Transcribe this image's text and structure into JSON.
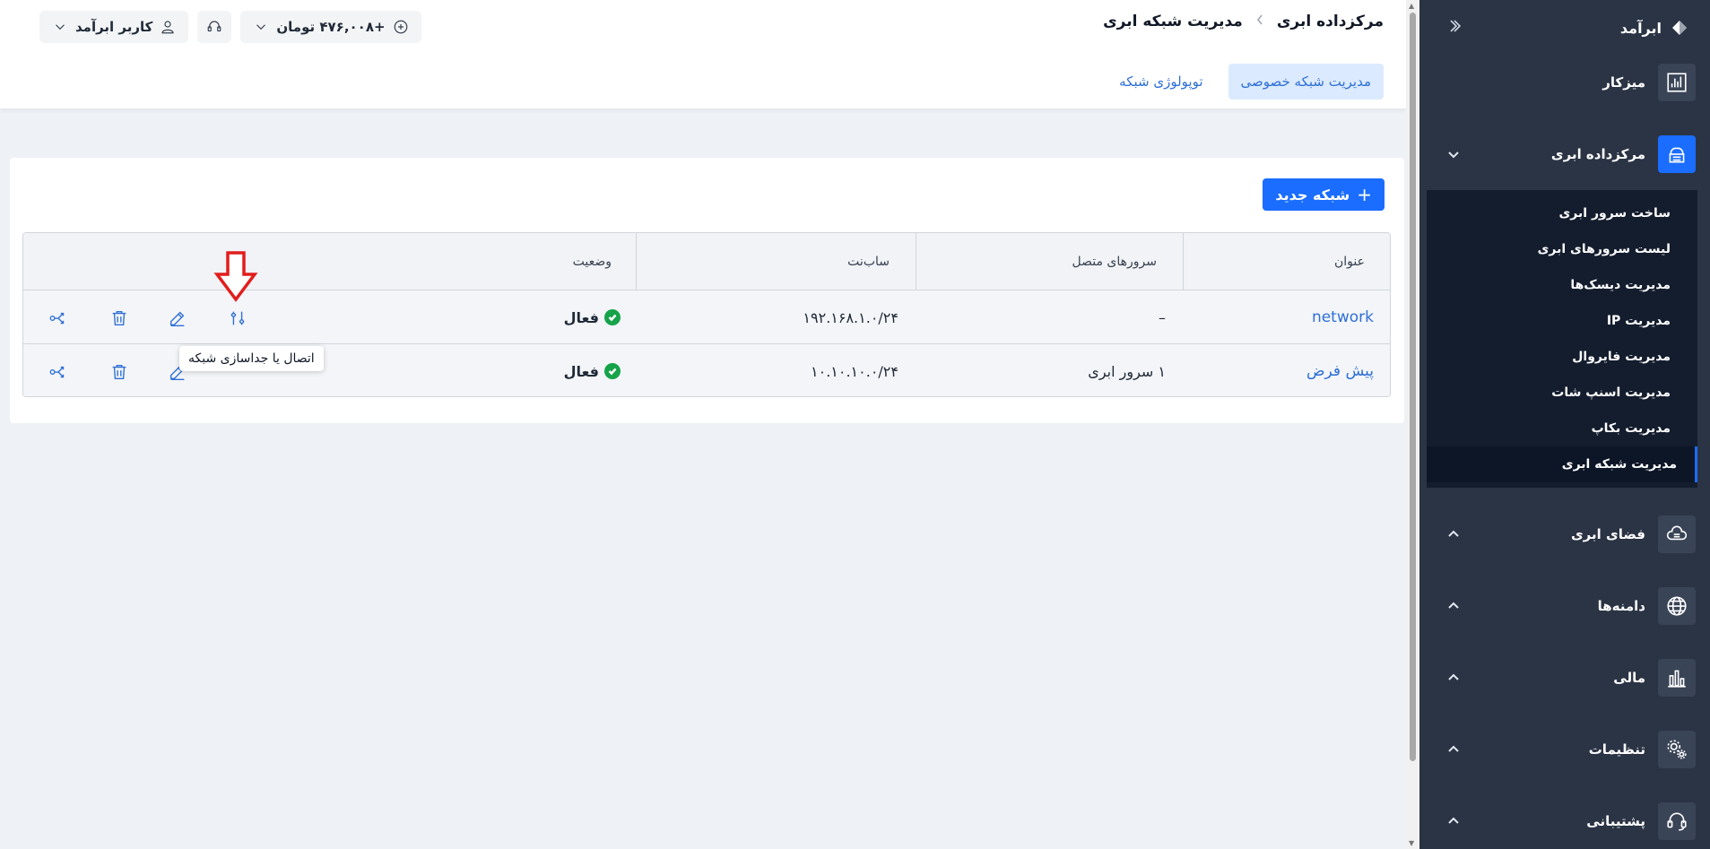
{
  "sidebar": {
    "brand": "ابرآمد",
    "items": [
      {
        "label": "میزکار"
      },
      {
        "label": "مرکزداده ابری"
      },
      {
        "label": "فضای ابری"
      },
      {
        "label": "دامنه‌ها"
      },
      {
        "label": "مالی"
      },
      {
        "label": "تنظیمات"
      },
      {
        "label": "پشتیبانی"
      }
    ],
    "submenu": [
      "ساخت سرور ابری",
      "لیست سرورهای ابری",
      "مدیریت دیسک‌ها",
      "مدیریت IP",
      "مدیریت فایروال",
      "مدیریت اسنپ شات",
      "مدیریت بکاپ",
      "مدیریت شبکه ابری"
    ],
    "accent_color": "#1a6dff"
  },
  "header": {
    "breadcrumb_root": "مرکزداده ابری",
    "breadcrumb_current": "مدیریت شبکه ابری",
    "user_label": "کاربر ابرآمد",
    "balance_label": "+۴۷۶,۰۰۸ تومان"
  },
  "tabs": [
    {
      "label": "مدیریت شبکه خصوصی",
      "active": true
    },
    {
      "label": "توپولوژی شبکه",
      "active": false
    }
  ],
  "new_button_label": "شبکه جدید",
  "table": {
    "columns": [
      "عنوان",
      "سرورهای متصل",
      "ساب‌نت",
      "وضعیت"
    ],
    "rows": [
      {
        "title": "network",
        "servers": "–",
        "subnet": "۱۹۲.۱۶۸.۱.۰/۲۴",
        "status": "فعال"
      },
      {
        "title": "پیش فرض",
        "servers": "۱ سرور ابری",
        "subnet": "۱۰.۱۰.۱۰.۰/۲۴",
        "status": "فعال"
      }
    ]
  },
  "tooltip": "اتصال یا جداسازی شبکه"
}
